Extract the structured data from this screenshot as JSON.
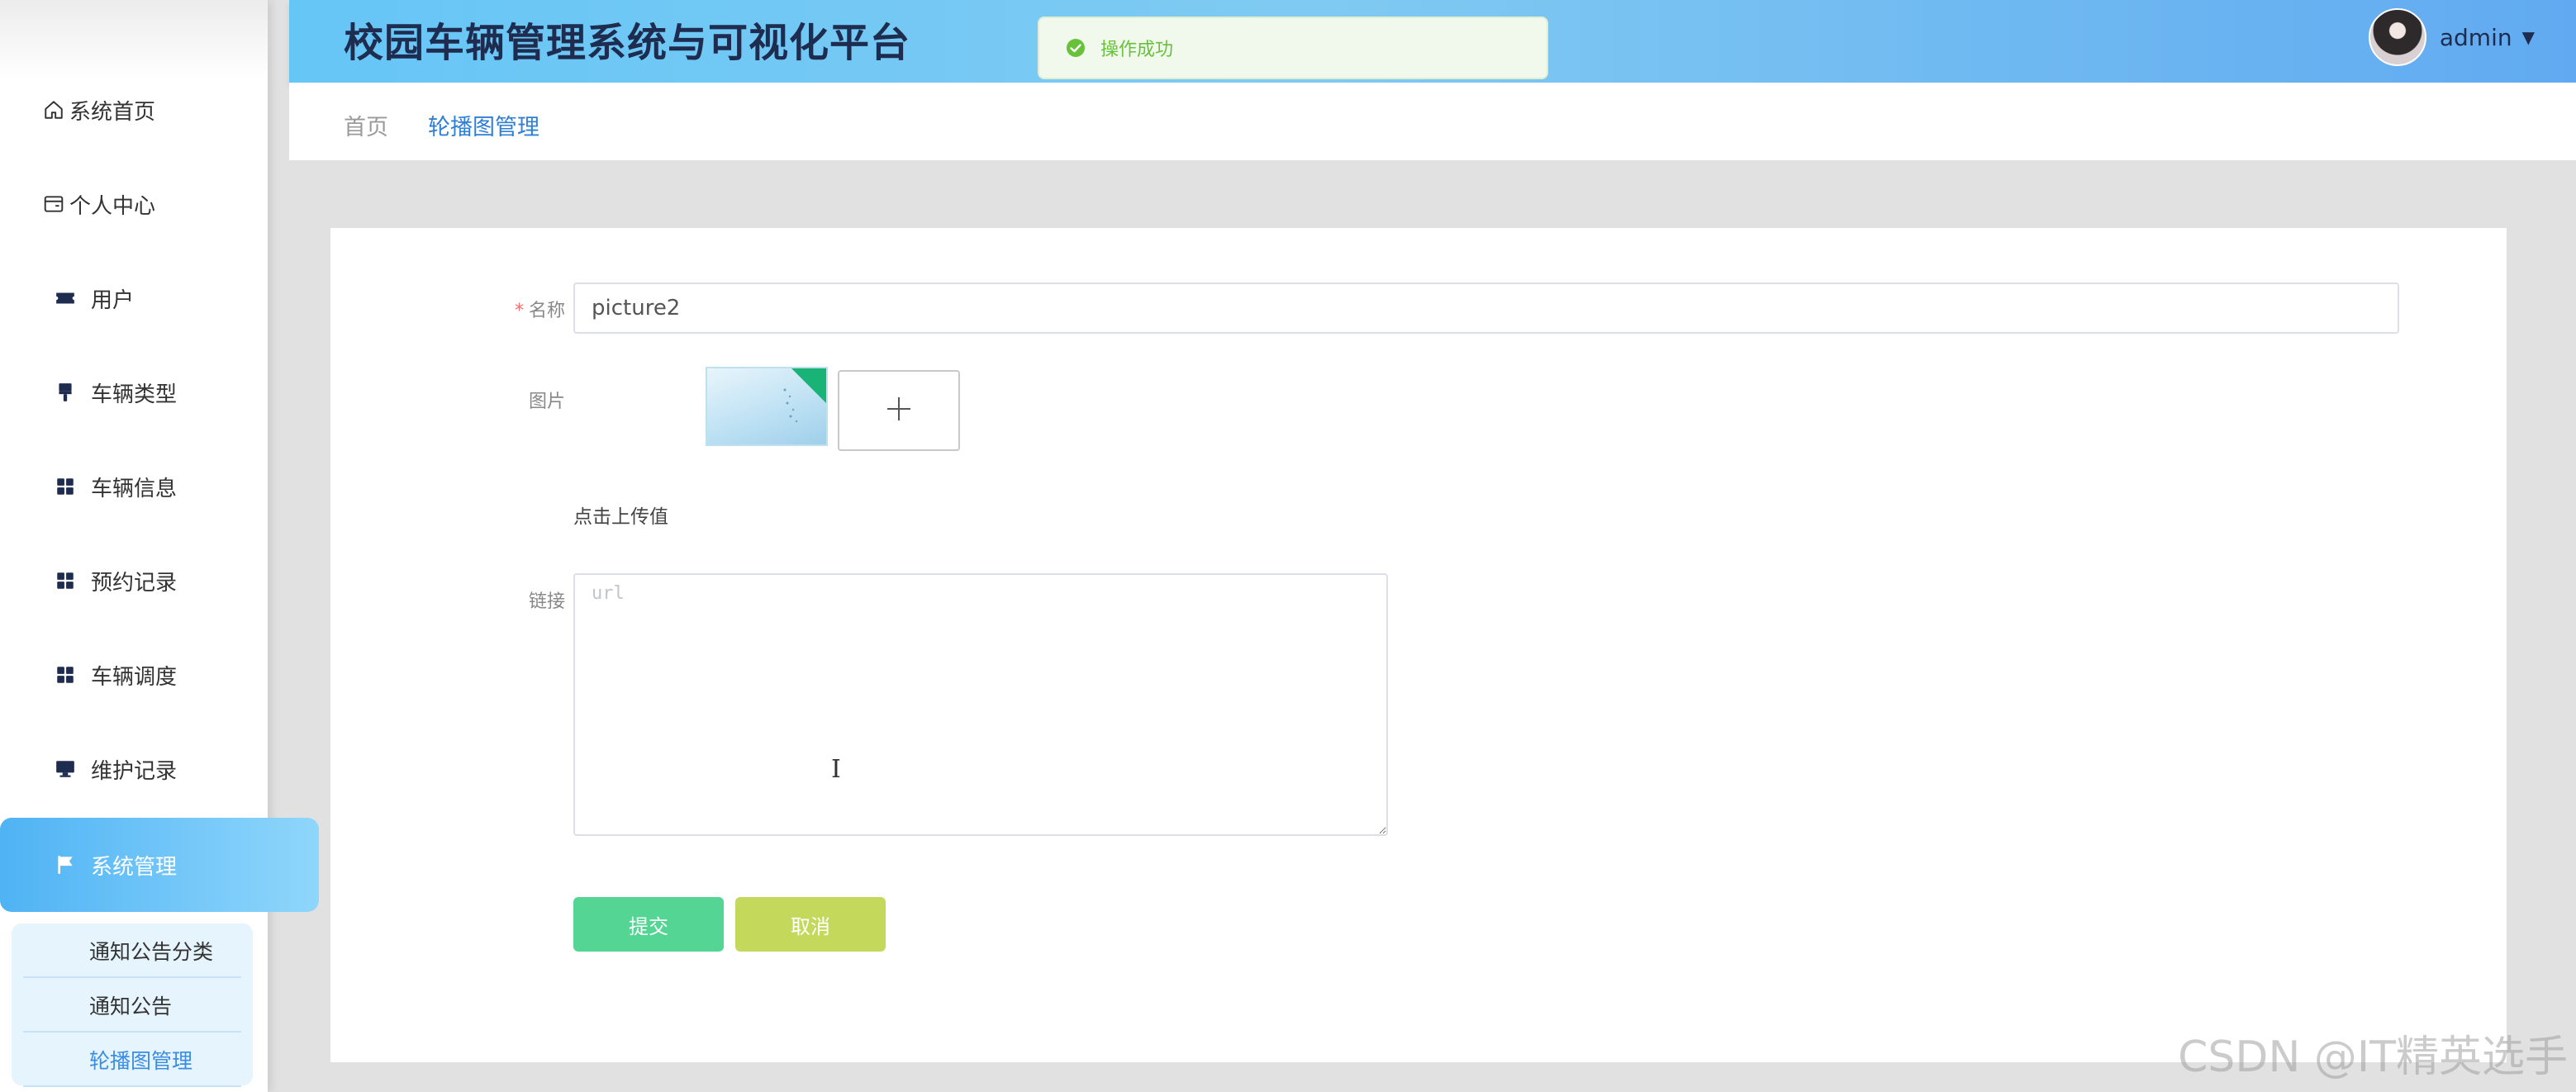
{
  "header": {
    "title": "校园车辆管理系统与可视化平台",
    "user_name": "admin",
    "avatar_icon": "user-avatar",
    "caret_icon": "caret-down-icon",
    "gradient_start": "#66c6f6",
    "gradient_end": "#61aaf1"
  },
  "toast": {
    "message": "操作成功",
    "icon": "check-circle-icon",
    "color": "#67c23a"
  },
  "sidebar": {
    "items": [
      {
        "label": "系统首页",
        "icon": "home-icon"
      },
      {
        "label": "个人中心",
        "icon": "id-card-icon"
      },
      {
        "label": "用户",
        "icon": "ticket-icon"
      },
      {
        "label": "车辆类型",
        "icon": "brush-icon"
      },
      {
        "label": "车辆信息",
        "icon": "grid-icon"
      },
      {
        "label": "预约记录",
        "icon": "grid-icon"
      },
      {
        "label": "车辆调度",
        "icon": "grid-icon"
      },
      {
        "label": "维护记录",
        "icon": "monitor-icon"
      },
      {
        "label": "系统管理",
        "icon": "flag-icon",
        "active": true
      }
    ],
    "submenu": [
      {
        "label": "通知公告分类"
      },
      {
        "label": "通知公告"
      },
      {
        "label": "轮播图管理",
        "current": true
      }
    ],
    "accent_color": "#4fb3f4"
  },
  "breadcrumb": {
    "home": "首页",
    "current": "轮播图管理"
  },
  "form": {
    "name_label": "名称",
    "name_required_mark": "*",
    "name_value": "picture2",
    "image_label": "图片",
    "upload_hint": "点击上传值",
    "upload_icon": "plus-icon",
    "link_label": "链接",
    "link_placeholder": "url",
    "link_value": "",
    "submit_label": "提交",
    "cancel_label": "取消",
    "submit_color": "#54d593",
    "cancel_color": "#c4d95c"
  },
  "watermark": "CSDN @IT精英选手"
}
